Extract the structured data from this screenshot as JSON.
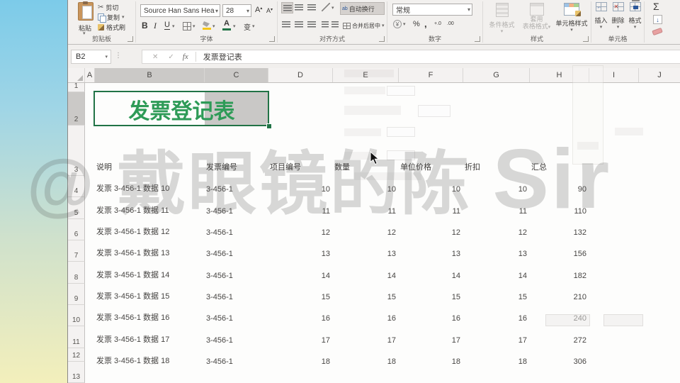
{
  "ribbon": {
    "clipboard": {
      "paste": "粘贴",
      "cut": "剪切",
      "copy": "复制",
      "format_painter": "格式刷",
      "label": "剪贴板"
    },
    "font": {
      "family": "Source Han Sans Hea",
      "size": "28",
      "bold": "B",
      "italic": "I",
      "underline": "U",
      "font_color_letter": "A",
      "grow_letter": "A",
      "shrink_letter": "A",
      "phonetic": "变",
      "label": "字体"
    },
    "alignment": {
      "wrap_text": "自动换行",
      "merge_center": "合并后居中",
      "label": "对齐方式"
    },
    "number": {
      "format": "常规",
      "currency": "¥",
      "percent": "%",
      "comma": ",",
      "inc_decimal": "+.0",
      "dec_decimal": ".00",
      "label": "数字"
    },
    "styles": {
      "conditional": "条件格式",
      "format_table_line1": "套用",
      "format_table_line2": "表格格式",
      "cell_styles": "单元格样式",
      "label": "样式"
    },
    "cells": {
      "insert": "插入",
      "delete": "删除",
      "format": "格式",
      "label": "单元格"
    },
    "editing": {
      "sum": "Σ"
    }
  },
  "formula_bar": {
    "cell_ref": "B2",
    "cancel": "✕",
    "enter": "✓",
    "fx": "fx",
    "content": "发票登记表"
  },
  "sheet": {
    "col_headers": [
      "A",
      "B",
      "C",
      "D",
      "E",
      "F",
      "G",
      "H",
      "I",
      "J"
    ],
    "row_headers": [
      "1",
      "2",
      "3",
      "4",
      "5",
      "6",
      "7",
      "8",
      "9",
      "10",
      "11",
      "12",
      "13"
    ],
    "title": "发票登记表"
  },
  "table": {
    "headers": [
      "说明",
      "发票编号",
      "项目编号",
      "数量",
      "单位价格",
      "折扣",
      "汇总"
    ],
    "rows": [
      [
        "发票 3-456-1 数据 10",
        "3-456-1",
        "10",
        "10",
        "10",
        "10",
        "90"
      ],
      [
        "发票 3-456-1 数据 11",
        "3-456-1",
        "11",
        "11",
        "11",
        "11",
        "110"
      ],
      [
        "发票 3-456-1 数据 12",
        "3-456-1",
        "12",
        "12",
        "12",
        "12",
        "132"
      ],
      [
        "发票 3-456-1 数据 13",
        "3-456-1",
        "13",
        "13",
        "13",
        "13",
        "156"
      ],
      [
        "发票 3-456-1 数据 14",
        "3-456-1",
        "14",
        "14",
        "14",
        "14",
        "182"
      ],
      [
        "发票 3-456-1 数据 15",
        "3-456-1",
        "15",
        "15",
        "15",
        "15",
        "210"
      ],
      [
        "发票 3-456-1 数据 16",
        "3-456-1",
        "16",
        "16",
        "16",
        "16",
        "240"
      ],
      [
        "发票 3-456-1 数据 17",
        "3-456-1",
        "17",
        "17",
        "17",
        "17",
        "272"
      ],
      [
        "发票 3-456-1 数据 18",
        "3-456-1",
        "18",
        "18",
        "18",
        "18",
        "306"
      ]
    ]
  },
  "watermark": {
    "prefix": "@ 戴眼镜的陈 ",
    "suffix": "Sir"
  },
  "colors": {
    "excel_green": "#217346",
    "title_green": "#2e9b57"
  }
}
